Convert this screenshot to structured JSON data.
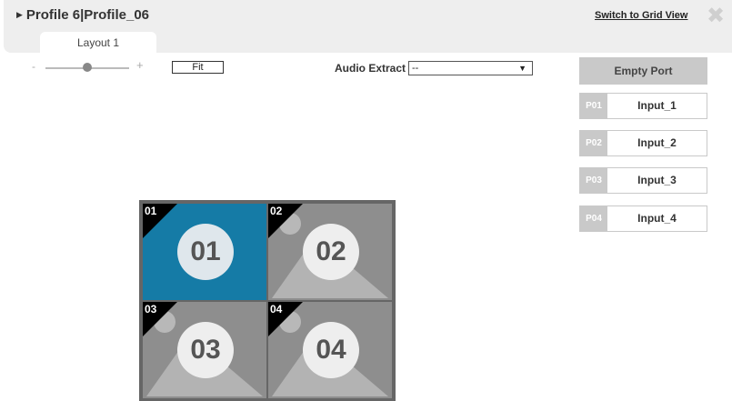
{
  "header": {
    "profile_title": "Profile 6|Profile_06",
    "switch_link": "Switch to Grid View",
    "close_symbol": "✖"
  },
  "tabs": [
    {
      "label": "Layout 1"
    }
  ],
  "zoom": {
    "minus": "-",
    "plus": "+",
    "level": 0.5
  },
  "toolbar": {
    "fit_label": "Fit"
  },
  "audio": {
    "label": "Audio Extract",
    "selected": "--",
    "arrow": "▼"
  },
  "ports": {
    "empty_label": "Empty Port",
    "items": [
      {
        "id": "P01",
        "name": "Input_1"
      },
      {
        "id": "P02",
        "name": "Input_2"
      },
      {
        "id": "P03",
        "name": "Input_3"
      },
      {
        "id": "P04",
        "name": "Input_4"
      }
    ]
  },
  "windows": [
    {
      "badge": "01",
      "label": "01",
      "active": true
    },
    {
      "badge": "02",
      "label": "02",
      "active": false
    },
    {
      "badge": "03",
      "label": "03",
      "active": false
    },
    {
      "badge": "04",
      "label": "04",
      "active": false
    }
  ],
  "colors": {
    "active_window": "#157ba6",
    "inactive_window": "#8e8e8e",
    "port_tag": "#c9c9c9"
  }
}
